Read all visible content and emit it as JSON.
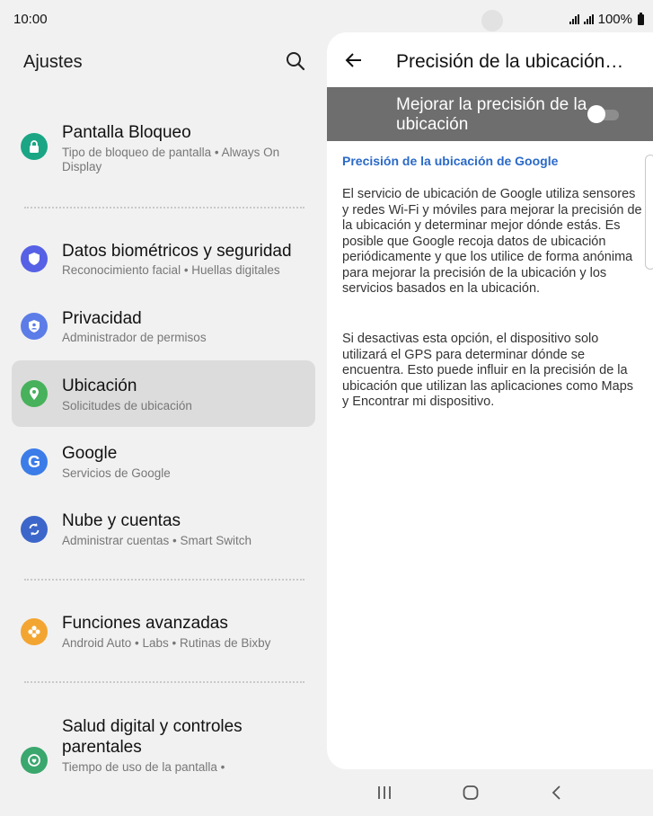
{
  "status_bar": {
    "time": "10:00",
    "battery": "100%"
  },
  "settings": {
    "title": "Ajustes",
    "items": [
      {
        "title": "Pantalla Bloqueo",
        "subtitle": "Tipo de bloqueo de pantalla  •  Always On Display",
        "icon": "lock-icon",
        "color": "#1aa685"
      },
      {
        "title": "Datos biométricos y seguridad",
        "subtitle": "Reconocimiento facial  •  Huellas digitales",
        "icon": "shield-icon",
        "color": "#5661e6"
      },
      {
        "title": "Privacidad",
        "subtitle": "Administrador de permisos",
        "icon": "privacy-icon",
        "color": "#5c7de8"
      },
      {
        "title": "Ubicación",
        "subtitle": "Solicitudes de ubicación",
        "icon": "location-pin-icon",
        "color": "#48b15b"
      },
      {
        "title": "Google",
        "subtitle": "Servicios de Google",
        "icon": "google-icon",
        "color": "#3b7ce8"
      },
      {
        "title": "Nube y cuentas",
        "subtitle": "Administrar cuentas  •  Smart Switch",
        "icon": "sync-icon",
        "color": "#3c66c9"
      },
      {
        "title": "Funciones avanzadas",
        "subtitle": "Android Auto  •  Labs  •  Rutinas de Bixby",
        "icon": "advanced-features-icon",
        "color": "#f3a531"
      },
      {
        "title": "Salud digital y controles parentales",
        "subtitle": "Tiempo de uso de la pantalla  •",
        "icon": "digital-wellbeing-icon",
        "color": "#3aa76d"
      }
    ]
  },
  "detail": {
    "title": "Precisión de la ubicación…",
    "toggle_label": "Mejorar la precisión de la ubicación",
    "toggle_state": "off",
    "section_heading": "Precisión de la ubicación de Google",
    "paragraph1": "El servicio de ubicación de Google utiliza sensores y redes Wi-Fi y móviles para mejorar la precisión de la ubicación y determinar mejor dónde estás. Es posible que Google recoja datos de ubicación periódicamente y que los utilice de forma anónima para mejorar la precisión de la ubicación y los servicios basados en la ubicación.",
    "paragraph2": "Si desactivas esta opción, el dispositivo solo utilizará el GPS para determinar dónde se encuentra. Esto puede influir en la precisión de la ubicación que utilizan las aplicaciones como Maps y Encontrar mi dispositivo."
  },
  "colors": {
    "accent": "#2a69c8",
    "toggle_bar": "#6e6e6e",
    "selected_row": "#dcdcdc",
    "background": "#f1f1f1"
  }
}
